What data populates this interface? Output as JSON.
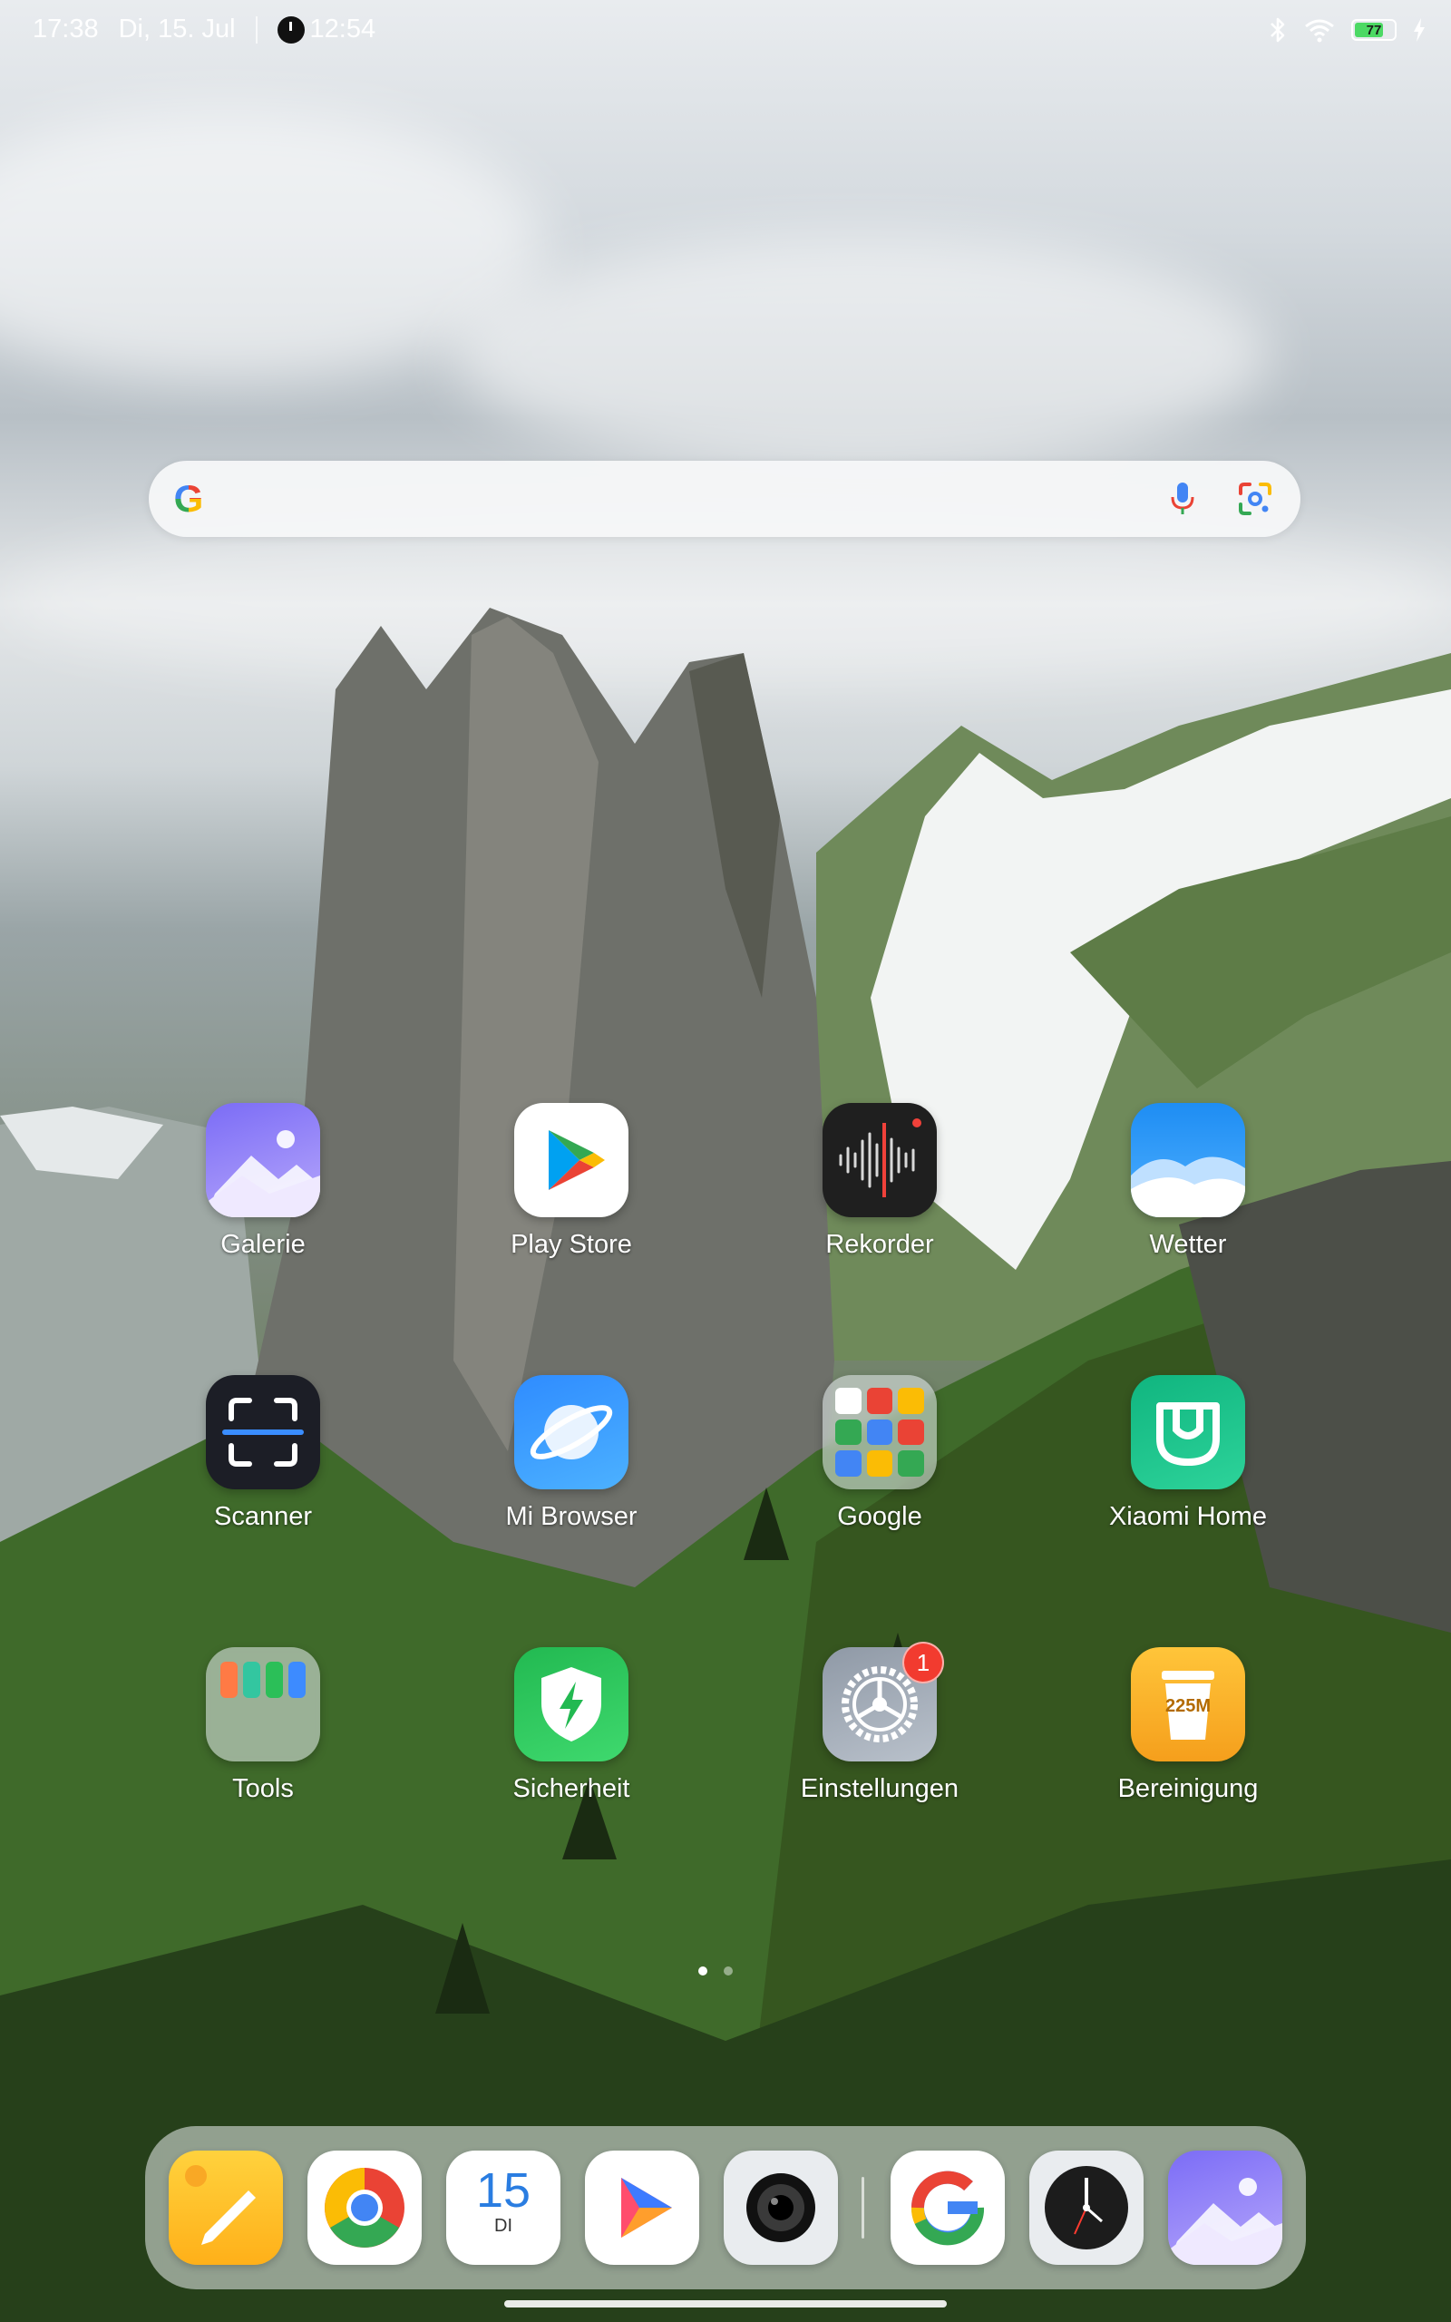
{
  "status_bar": {
    "time": "17:38",
    "date": "Di, 15. Jul",
    "alarm_time": "12:54",
    "battery_level": 77,
    "battery_text": "77"
  },
  "search": {
    "placeholder": ""
  },
  "apps": [
    {
      "label": "Galerie"
    },
    {
      "label": "Play Store"
    },
    {
      "label": "Rekorder"
    },
    {
      "label": "Wetter"
    },
    {
      "label": "Scanner"
    },
    {
      "label": "Mi Browser"
    },
    {
      "label": "Google"
    },
    {
      "label": "Xiaomi Home"
    },
    {
      "label": "Tools"
    },
    {
      "label": "Sicherheit"
    },
    {
      "label": "Einstellungen",
      "badge": "1"
    },
    {
      "label": "Bereinigung",
      "icon_text": "225M"
    }
  ],
  "dock": {
    "calendar_day": "15",
    "calendar_weekday": "DI",
    "items": [
      "notes-icon",
      "chrome-icon",
      "calendar-icon",
      "video-player-icon",
      "camera-icon",
      "google-icon",
      "clock-icon",
      "gallery-icon"
    ]
  },
  "page_indicator": {
    "current": 1,
    "total": 2
  },
  "colors": {
    "badge_red": "#f23b2f",
    "battery_green": "#4cd964",
    "gallery_purple": "#8a7cf6",
    "xiaomi_home_green": "#16b584",
    "sicherheit_green": "#27c45a",
    "bereinigung_orange": "#f5a524"
  }
}
